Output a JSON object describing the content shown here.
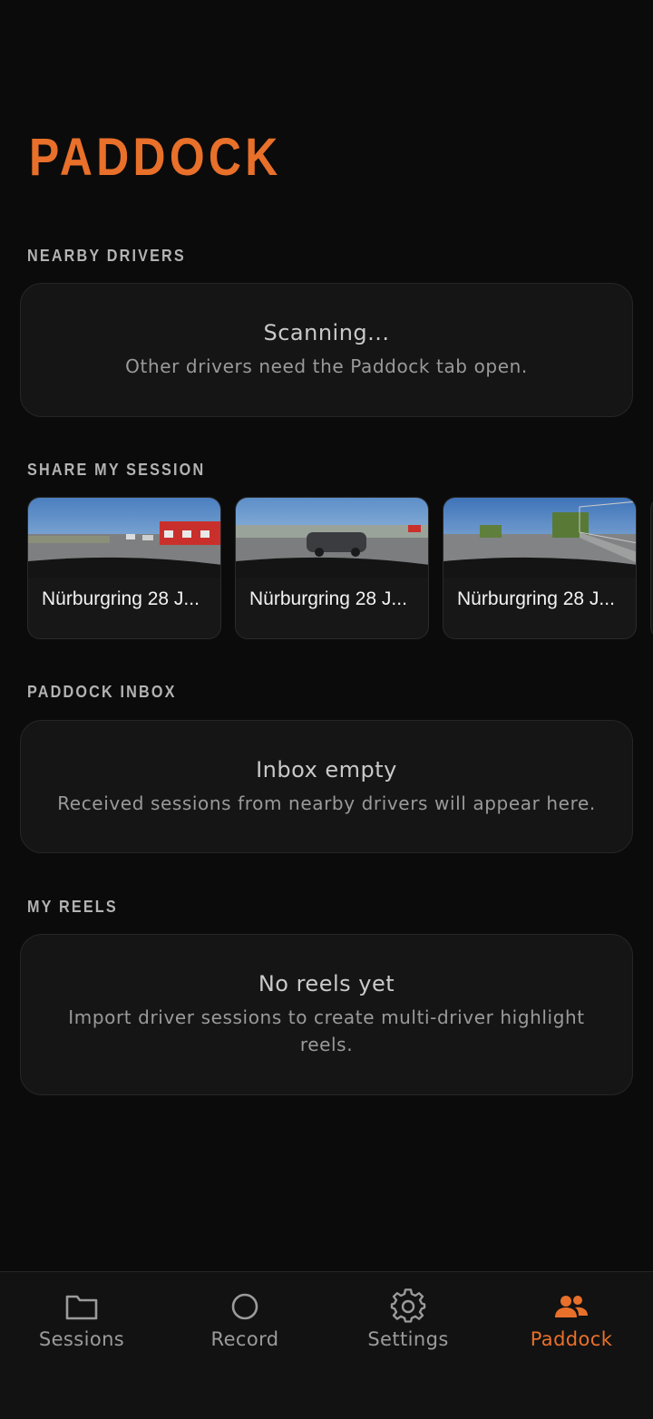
{
  "colors": {
    "accent": "#e8702a",
    "background": "#0b0b0b",
    "card": "#151515"
  },
  "page": {
    "title": "PADDOCK"
  },
  "nearby": {
    "label": "NEARBY DRIVERS",
    "title": "Scanning...",
    "subtitle": "Other drivers need the Paddock tab open."
  },
  "share": {
    "label": "SHARE MY SESSION",
    "sessions": [
      {
        "title": "Nürburgring 28 J..."
      },
      {
        "title": "Nürburgring 28 J..."
      },
      {
        "title": "Nürburgring 28 J..."
      }
    ]
  },
  "inbox": {
    "label": "PADDOCK INBOX",
    "title": "Inbox empty",
    "subtitle": "Received sessions from nearby drivers will appear here."
  },
  "reels": {
    "label": "MY REELS",
    "title": "No reels yet",
    "subtitle": "Import driver sessions to create multi-driver highlight reels."
  },
  "tabs": [
    {
      "label": "Sessions",
      "icon": "folder-icon",
      "active": false
    },
    {
      "label": "Record",
      "icon": "record-circle-icon",
      "active": false
    },
    {
      "label": "Settings",
      "icon": "gear-icon",
      "active": false
    },
    {
      "label": "Paddock",
      "icon": "people-icon",
      "active": true
    }
  ]
}
